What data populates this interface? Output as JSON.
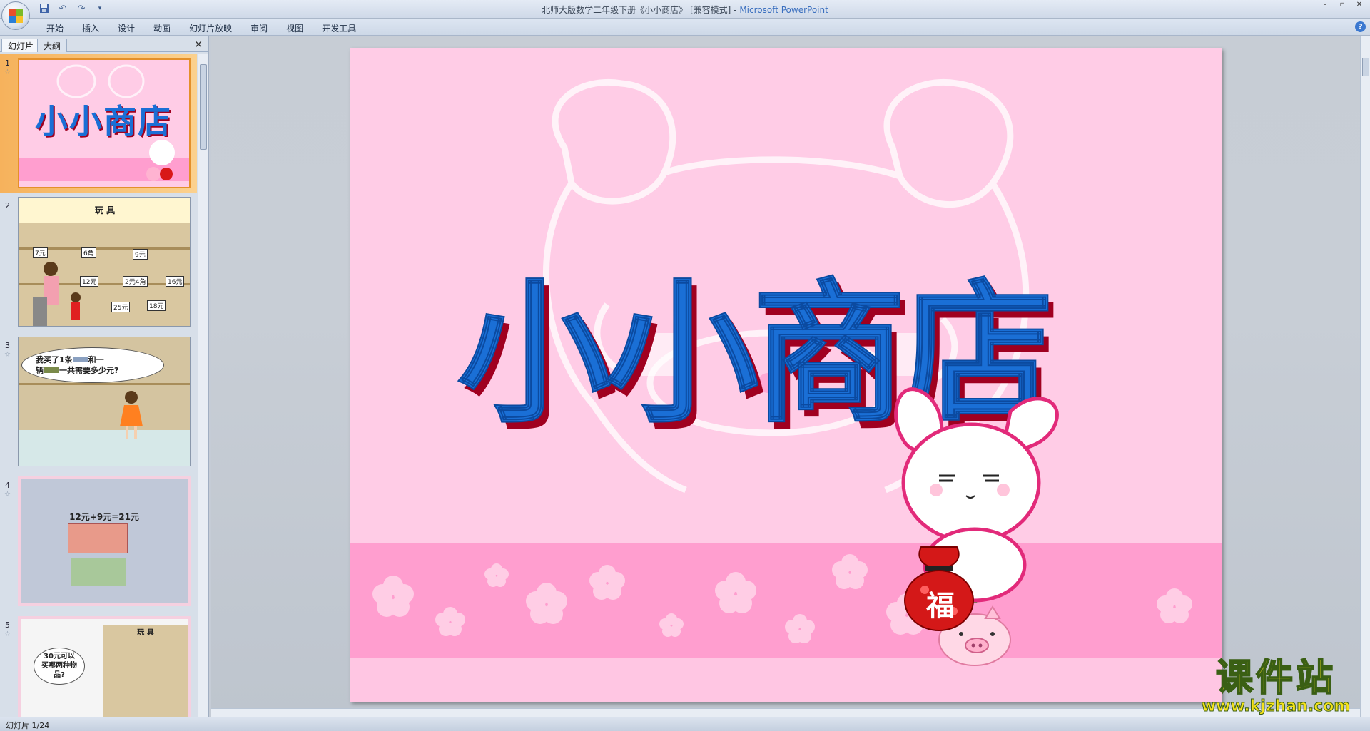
{
  "window": {
    "title": "北师大版数学二年级下册《小小商店》 [兼容模式] - ",
    "app_name": "Microsoft PowerPoint"
  },
  "ribbon": {
    "tabs": [
      "开始",
      "插入",
      "设计",
      "动画",
      "幻灯片放映",
      "审阅",
      "视图",
      "开发工具"
    ]
  },
  "panel": {
    "tab_slides": "幻灯片",
    "tab_outline": "大纲",
    "slides": [
      {
        "number": "1",
        "title": "小小商店"
      },
      {
        "number": "2",
        "header": "玩 具",
        "prices": [
          "7元",
          "6角",
          "9元",
          "12元",
          "2元4角",
          "16元",
          "25元",
          "18元"
        ]
      },
      {
        "number": "3",
        "bubble_line1": "我买了1条",
        "bubble_mid": "和一",
        "bubble_line2": "辆",
        "bubble_end": "一共需要多少元?"
      },
      {
        "number": "4",
        "equation": "12元+9元=21元"
      },
      {
        "number": "5",
        "bubble": "30元可以买哪两种物品?",
        "header": "玩 具"
      }
    ]
  },
  "slide": {
    "title": "小小商店",
    "bag_char": "福"
  },
  "status": {
    "text": "幻灯片 1/24"
  },
  "watermark": {
    "cn": "课件站",
    "url": "www.kjzhan.com"
  },
  "colors": {
    "slide_bg": "#ffcce6",
    "title_fill": "#1a6fd6",
    "title_shadow": "#a00020",
    "band": "#ff9ecf",
    "selection": "#f6b25c"
  }
}
